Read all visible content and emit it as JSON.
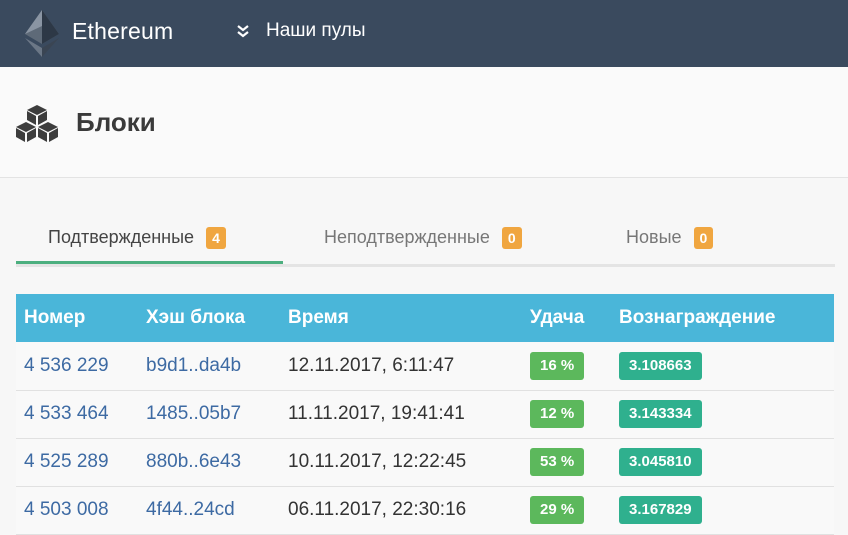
{
  "navbar": {
    "brand": "Ethereum",
    "menu_label": "Наши пулы"
  },
  "page": {
    "title": "Блоки"
  },
  "tabs": [
    {
      "label": "Подтвержденные",
      "count": "4",
      "active": true
    },
    {
      "label": "Неподтвержденные",
      "count": "0",
      "active": false
    },
    {
      "label": "Новые",
      "count": "0",
      "active": false
    }
  ],
  "table": {
    "headers": [
      "Номер",
      "Хэш блока",
      "Время",
      "Удача",
      "Вознаграждение"
    ],
    "rows": [
      {
        "number": "4 536 229",
        "hash": "b9d1..da4b",
        "time": "12.11.2017, 6:11:47",
        "luck": "16 %",
        "reward": "3.108663"
      },
      {
        "number": "4 533 464",
        "hash": "1485..05b7",
        "time": "11.11.2017, 19:41:41",
        "luck": "12 %",
        "reward": "3.143334"
      },
      {
        "number": "4 525 289",
        "hash": "880b..6e43",
        "time": "10.11.2017, 12:22:45",
        "luck": "53 %",
        "reward": "3.045810"
      },
      {
        "number": "4 503 008",
        "hash": "4f44..24cd",
        "time": "06.11.2017, 22:30:16",
        "luck": "29 %",
        "reward": "3.167829"
      }
    ]
  },
  "colors": {
    "navbar_bg": "#3a4a5e",
    "table_header_bg": "#4ab6d9",
    "tab_active_underline": "#4caf7f",
    "count_badge": "#f0a640",
    "luck_badge": "#5cb85c",
    "reward_badge": "#2fb08e",
    "link": "#3d6aa3"
  },
  "icons": {
    "logo": "ethereum-logo-icon",
    "menu": "double-chevron-down-icon",
    "title": "cubes-icon"
  }
}
